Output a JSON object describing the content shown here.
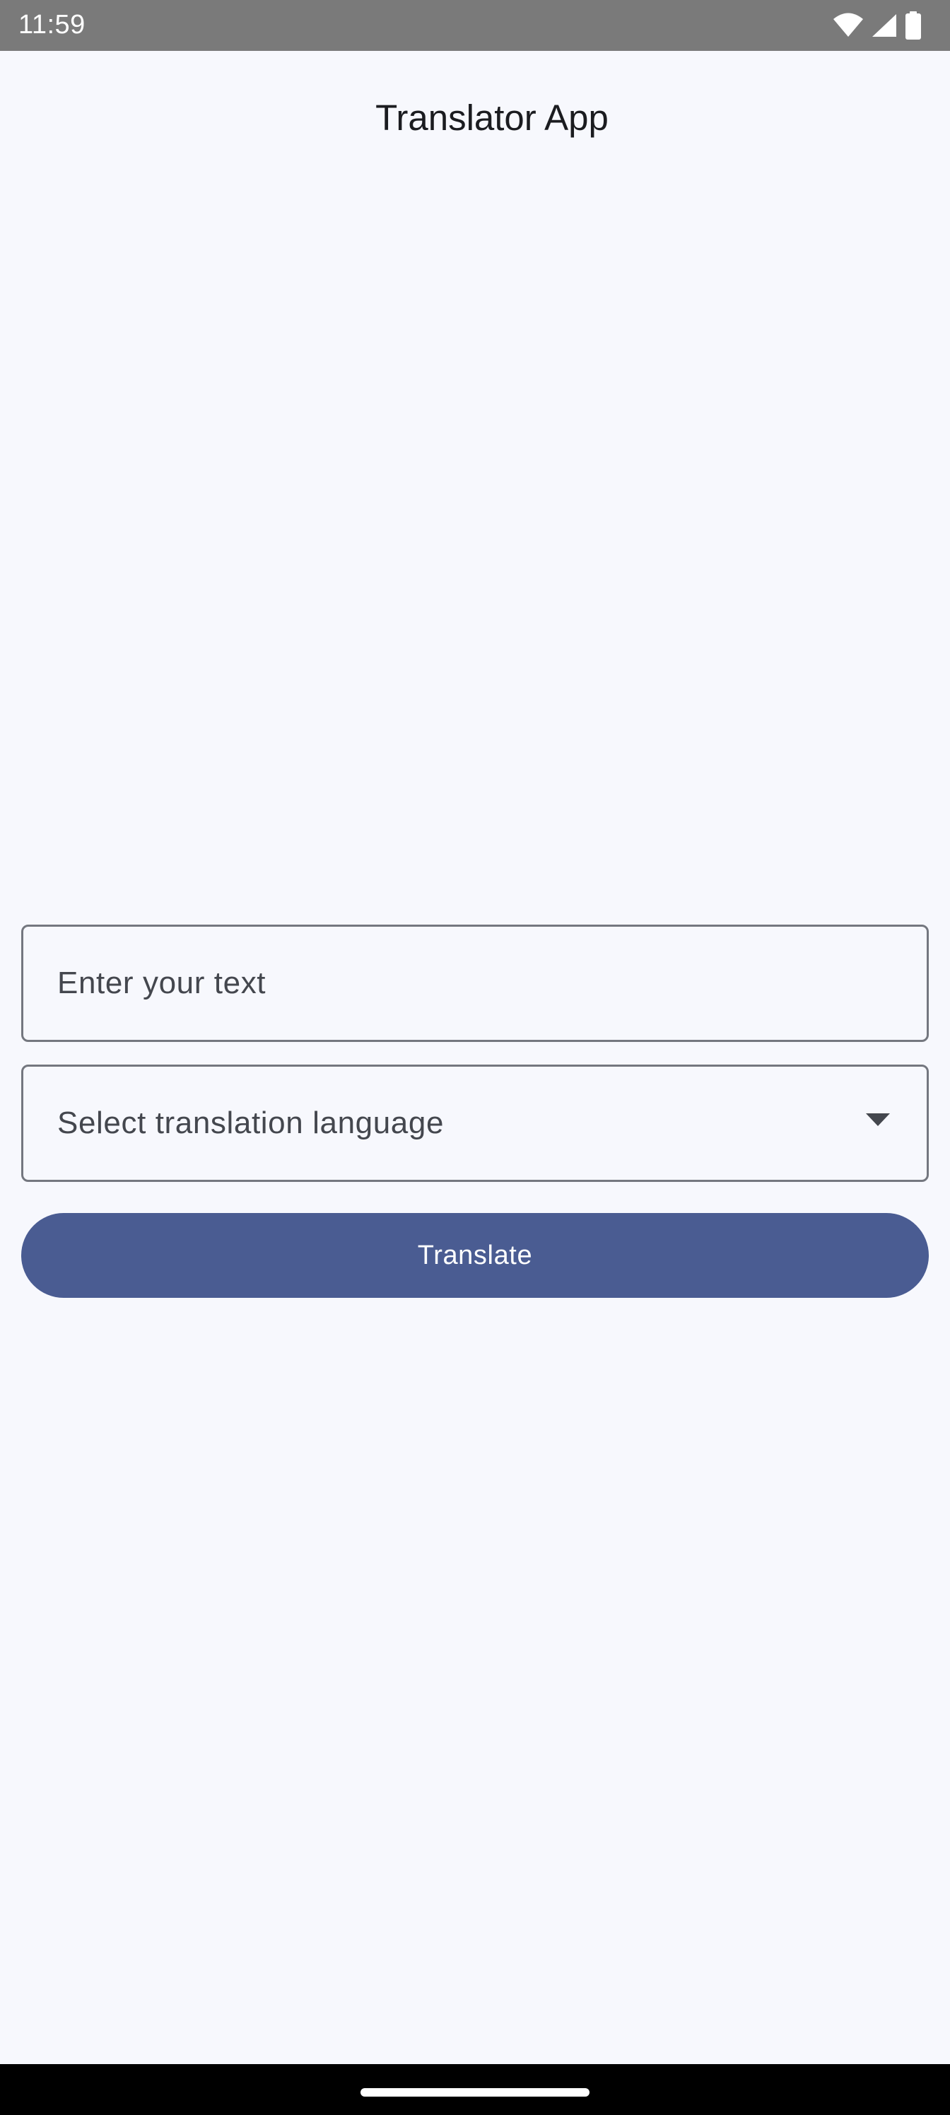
{
  "status_bar": {
    "time": "11:59",
    "icons": [
      "wifi-icon",
      "cellular-signal-icon",
      "battery-icon"
    ]
  },
  "app_bar": {
    "title": "Translator App"
  },
  "form": {
    "text_input": {
      "placeholder": "Enter your text",
      "value": ""
    },
    "language_select": {
      "placeholder": "Select translation language",
      "icon": "dropdown-arrow-icon"
    },
    "translate_button": {
      "label": "Translate"
    }
  },
  "colors": {
    "background": "#f7f8fd",
    "status_bar": "#7a7a7a",
    "primary": "#4a5c92",
    "outline": "#74777f",
    "on_surface": "#1b1c20",
    "on_surface_variant": "#44474e",
    "nav_bar": "#000000"
  }
}
